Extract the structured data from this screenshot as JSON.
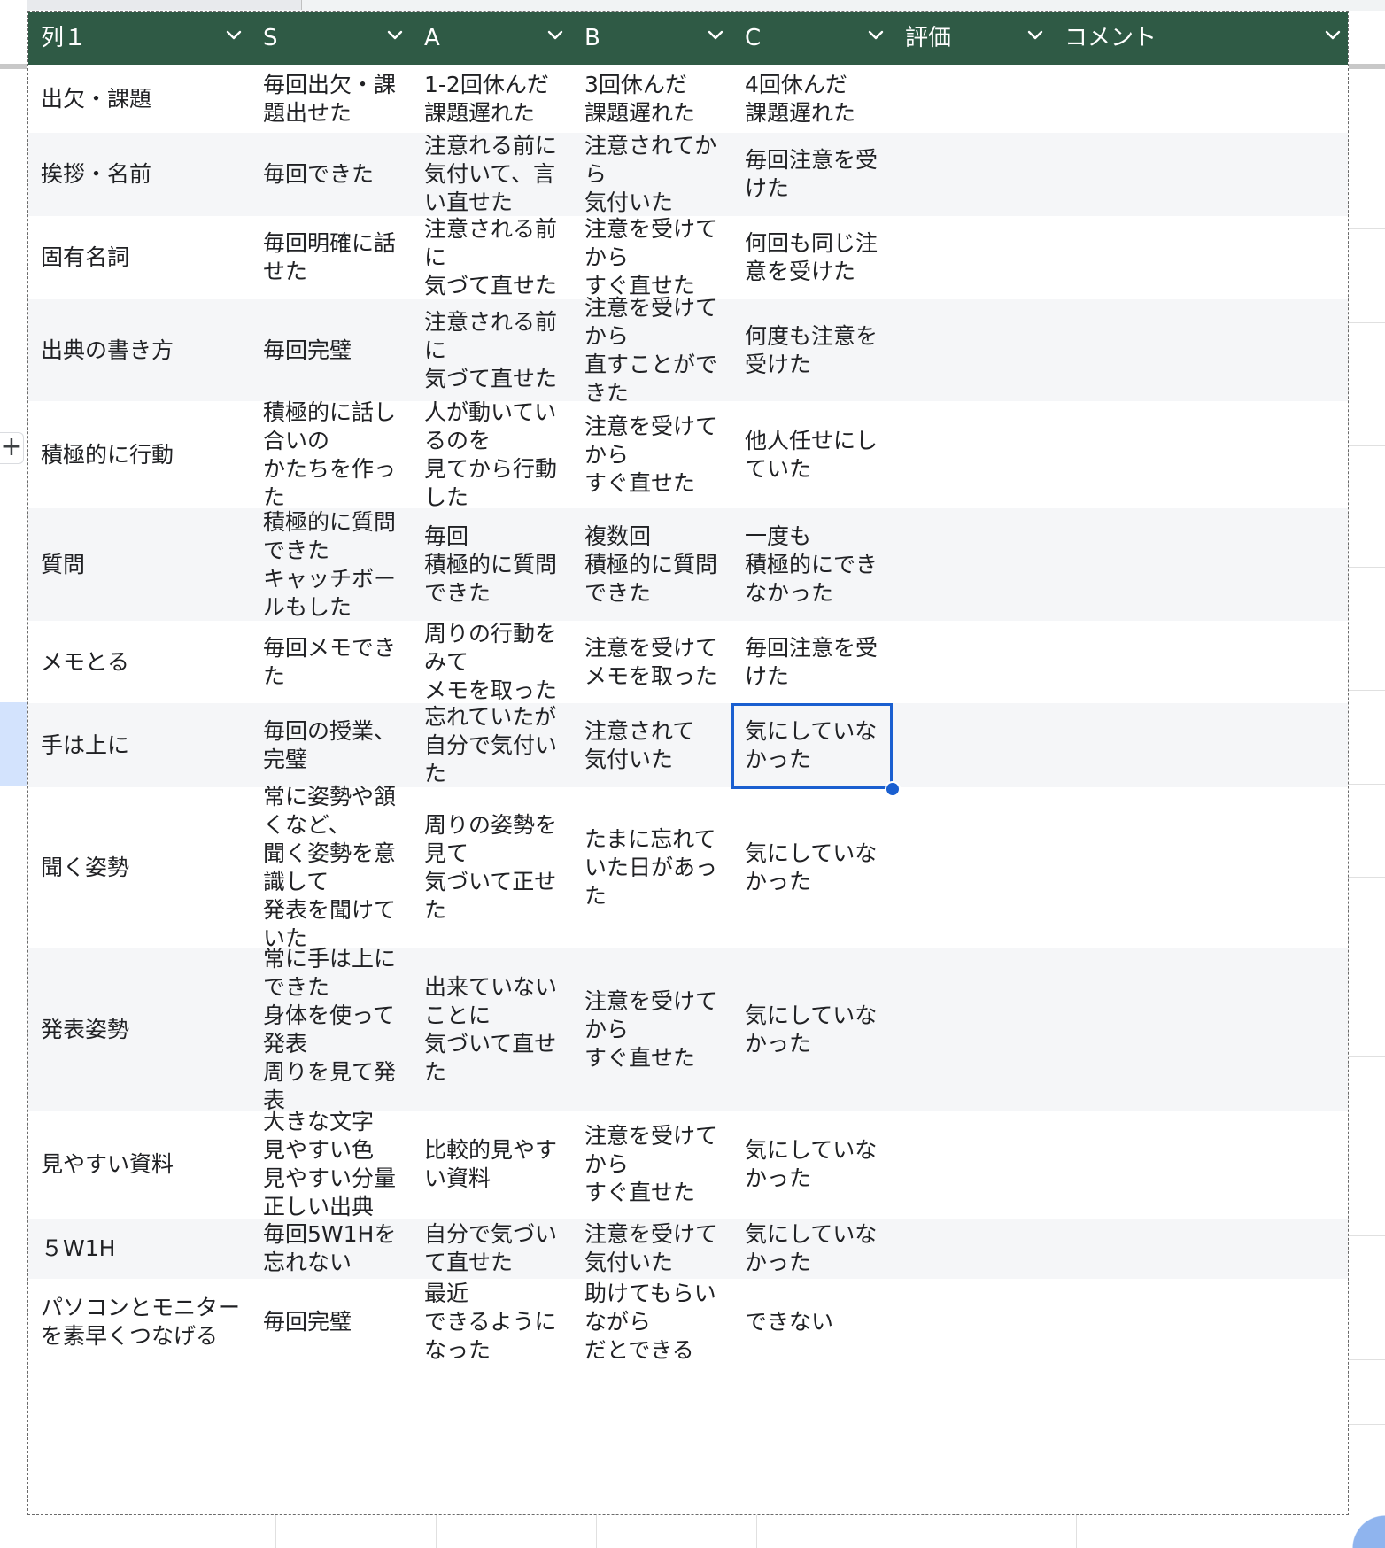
{
  "header": {
    "columns": [
      "列１",
      "S",
      "A",
      "B",
      "C",
      "評価",
      "コメント"
    ]
  },
  "rows": [
    {
      "cells": [
        "出欠・課題",
        "毎回出欠・課\n題出せた",
        "1-2回休んだ\n課題遅れた",
        "3回休んだ\n課題遅れた",
        "4回休んだ\n課題遅れた",
        "",
        ""
      ]
    },
    {
      "cells": [
        "挨拶・名前",
        "毎回できた",
        "注意れる前に\n気付いて、言\nい直せた",
        "注意されてか\nら\n気付いた",
        "毎回注意を受\nけた",
        "",
        ""
      ]
    },
    {
      "cells": [
        "固有名詞",
        "毎回明確に話\nせた",
        "注意される前\nに\n気づて直せた",
        "注意を受けて\nから\nすぐ直せた",
        "何回も同じ注\n意を受けた",
        "",
        ""
      ]
    },
    {
      "cells": [
        "出典の書き方",
        "毎回完璧",
        "注意される前\nに\n気づて直せた",
        "注意を受けて\nから\n直すことがで\nきた",
        "何度も注意を\n受けた",
        "",
        ""
      ]
    },
    {
      "cells": [
        "積極的に行動",
        "積極的に話し\n合いの\nかたちを作っ\nた",
        "人が動いてい\nるのを\n見てから行動\nした",
        "注意を受けて\nから\nすぐ直せた",
        "他人任せにし\nていた",
        "",
        ""
      ]
    },
    {
      "cells": [
        "質問",
        "積極的に質問\nできた\nキャッチボー\nルもした",
        "毎回\n積極的に質問\nできた",
        "複数回\n積極的に質問\nできた",
        "一度も\n積極的にでき\nなかった",
        "",
        ""
      ]
    },
    {
      "cells": [
        "メモとる",
        "毎回メモでき\nた",
        "周りの行動を\nみて\nメモを取った",
        "注意を受けて\nメモを取った",
        "毎回注意を受\nけた",
        "",
        ""
      ]
    },
    {
      "cells": [
        "手は上に",
        "毎回の授業、\n完璧",
        "忘れていたが\n自分で気付い\nた",
        "注意されて\n気付いた",
        "気にしていな\nかった",
        "",
        ""
      ]
    },
    {
      "cells": [
        "聞く姿勢",
        "常に姿勢や頷\nくなど、\n聞く姿勢を意\n識して\n発表を聞けて\nいた",
        "周りの姿勢を\n見て\n気づいて正せ\nた",
        "たまに忘れて\nいた日があっ\nた",
        "気にしていな\nかった",
        "",
        ""
      ]
    },
    {
      "cells": [
        "発表姿勢",
        "常に手は上に\nできた\n身体を使って\n発表\n周りを見て発\n表",
        "出来ていない\nことに\n気づいて直せ\nた",
        "注意を受けて\nから\nすぐ直せた",
        "気にしていな\nかった",
        "",
        ""
      ]
    },
    {
      "cells": [
        "見やすい資料",
        "大きな文字\n見やすい色\n見やすい分量\n正しい出典",
        "比較的見やす\nい資料",
        "注意を受けて\nから\nすぐ直せた",
        "気にしていな\nかった",
        "",
        ""
      ]
    },
    {
      "cells": [
        "５W1H",
        "毎回5W1Hを\n忘れない",
        "自分で気づい\nて直せた",
        "注意を受けて\n気付いた",
        "気にしていな\nかった",
        "",
        ""
      ]
    },
    {
      "cells": [
        "パソコンとモニター\nを素早くつなげる",
        "毎回完璧",
        "最近\nできるように\nなった",
        "助けてもらい\nながら\nだとできる",
        "できない",
        "",
        ""
      ]
    }
  ],
  "selection": {
    "row": 7,
    "col": 4
  },
  "theme": {
    "header_bg": "#2f5a45",
    "header_text": "#ffffff",
    "alt_row_bg": "#f5f6f8",
    "selection": "#1a5fd0"
  },
  "icons": {
    "column_menu": "chevron-down-icon",
    "add_row": "plus-icon"
  },
  "add_button_label": "+"
}
